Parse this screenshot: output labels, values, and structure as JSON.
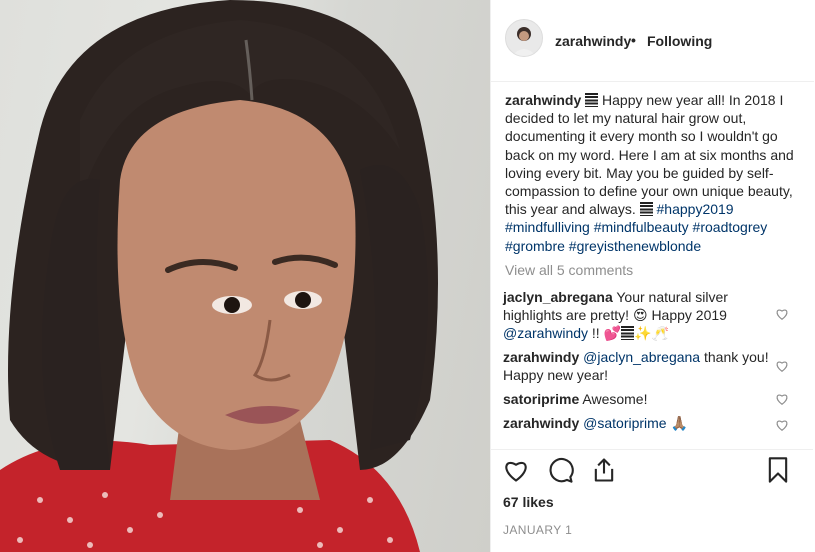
{
  "post": {
    "author": "zarahwindy",
    "follow_separator": "•",
    "follow_status": "Following"
  },
  "caption": {
    "username": "zarahwindy",
    "text_1": " Happy new year all! In 2018 I decided to let my natural hair grow out, documenting it every month so I wouldn't go back on my word. Here I am at six months and loving every bit. May you be guided by self-compassion to define your own unique beauty, this year and always. ",
    "hashtags": "#happy2019 #mindfulliving #mindfulbeauty #roadtogrey #grombre #greyisthenewblonde"
  },
  "view_all_comments": "View all 5 comments",
  "comments": [
    {
      "user": "jaclyn_abregana",
      "text": " Your natural silver highlights are pretty! 😍 Happy 2019 ",
      "mention": "@zarahwindy",
      "tail": " !! 💕",
      "tail2": "✨🥂"
    },
    {
      "user": "zarahwindy",
      "mention": "@jaclyn_abregana",
      "text": " thank you! Happy new year!"
    },
    {
      "user": "satoriprime",
      "text": " Awesome!"
    },
    {
      "user": "zarahwindy",
      "mention": "@satoriprime",
      "text": " 🙏🏽"
    }
  ],
  "likes": "67 likes",
  "date": "JANUARY 1",
  "icons": {
    "like": "heart-icon",
    "comment": "comment-bubble-icon",
    "share": "share-icon",
    "save": "bookmark-icon",
    "comment_like": "small-heart-icon"
  },
  "colors": {
    "hashtag": "#003569",
    "muted": "#8e8e8e",
    "text": "#262626"
  }
}
